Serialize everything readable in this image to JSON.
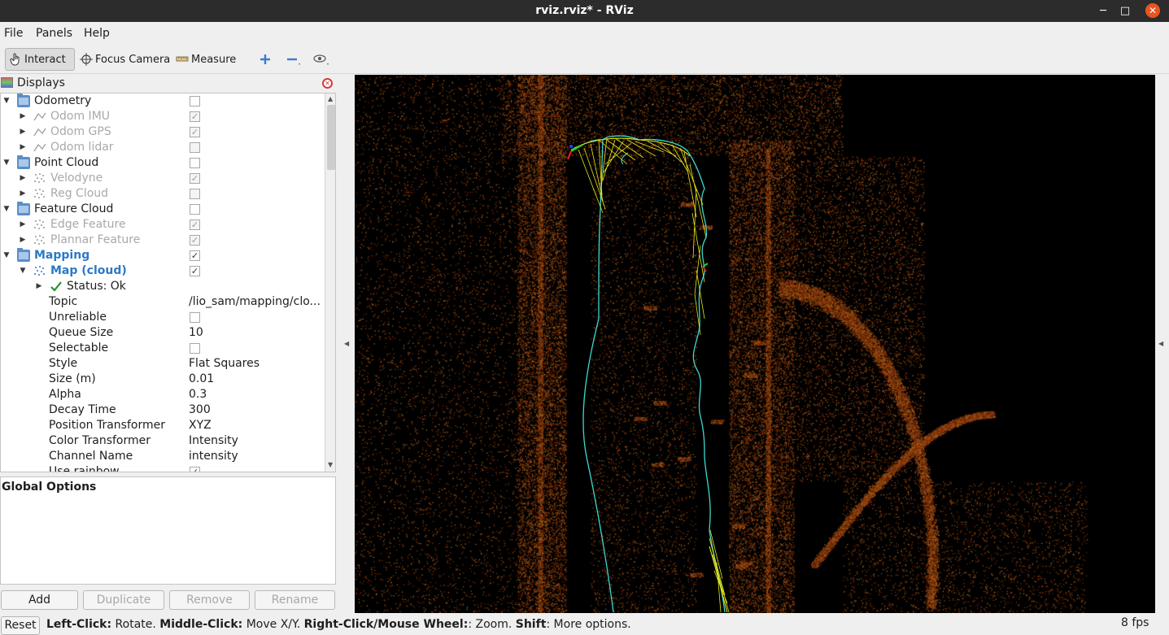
{
  "window": {
    "title": "rviz.rviz* - RViz",
    "minimize": "─",
    "maximize": "□",
    "close": "✕"
  },
  "menu": {
    "file": "File",
    "panels": "Panels",
    "help": "Help"
  },
  "toolbar": {
    "interact": "Interact",
    "focus_camera": "Focus Camera",
    "measure": "Measure",
    "add_icon": "plus-icon",
    "remove_icon": "minus-icon",
    "view_icon": "eye-icon"
  },
  "displays": {
    "title": "Displays",
    "rows": [
      {
        "label": "Odometry",
        "kind": "folder",
        "checked": false
      },
      {
        "label": "Odom IMU",
        "kind": "odom",
        "checked": true
      },
      {
        "label": "Odom GPS",
        "kind": "odom",
        "checked": true
      },
      {
        "label": "Odom lidar",
        "kind": "odom",
        "checked": false
      },
      {
        "label": "Point Cloud",
        "kind": "folder",
        "checked": false
      },
      {
        "label": "Velodyne",
        "kind": "cloud",
        "checked": true
      },
      {
        "label": "Reg Cloud",
        "kind": "cloud",
        "checked": false
      },
      {
        "label": "Feature Cloud",
        "kind": "folder",
        "checked": false
      },
      {
        "label": "Edge Feature",
        "kind": "cloud",
        "checked": true
      },
      {
        "label": "Plannar Feature",
        "kind": "cloud",
        "checked": true
      },
      {
        "label": "Mapping",
        "kind": "folder",
        "checked": true
      },
      {
        "label": "Map (cloud)",
        "kind": "cloud",
        "checked": true
      },
      {
        "label": "Status: Ok",
        "kind": "status"
      }
    ],
    "properties": [
      {
        "name": "Topic",
        "value": "/lio_sam/mapping/clo..."
      },
      {
        "name": "Unreliable",
        "check": false
      },
      {
        "name": "Queue Size",
        "value": "10"
      },
      {
        "name": "Selectable",
        "check": false
      },
      {
        "name": "Style",
        "value": "Flat Squares"
      },
      {
        "name": "Size (m)",
        "value": "0.01"
      },
      {
        "name": "Alpha",
        "value": "0.3"
      },
      {
        "name": "Decay Time",
        "value": "300"
      },
      {
        "name": "Position Transformer",
        "value": "XYZ"
      },
      {
        "name": "Color Transformer",
        "value": "Intensity"
      },
      {
        "name": "Channel Name",
        "value": "intensity"
      },
      {
        "name": "Use rainbow",
        "check": true
      }
    ]
  },
  "global_options": {
    "title": "Global Options"
  },
  "buttons": {
    "add": "Add",
    "duplicate": "Duplicate",
    "remove": "Remove",
    "rename": "Rename"
  },
  "status": {
    "reset": "Reset",
    "lc": "Left-Click:",
    "lc_d": " Rotate. ",
    "mc": "Middle-Click:",
    "mc_d": " Move X/Y. ",
    "rc": "Right-Click/Mouse Wheel:",
    "rc_d": ": Zoom. ",
    "sh": "Shift",
    "sh_d": ": More options.",
    "fps": "8 fps"
  },
  "colors": {
    "accent": "#2b79c7",
    "path": "#3fd8d0",
    "keyframes": "#e8e81a",
    "close": "#e95420"
  }
}
